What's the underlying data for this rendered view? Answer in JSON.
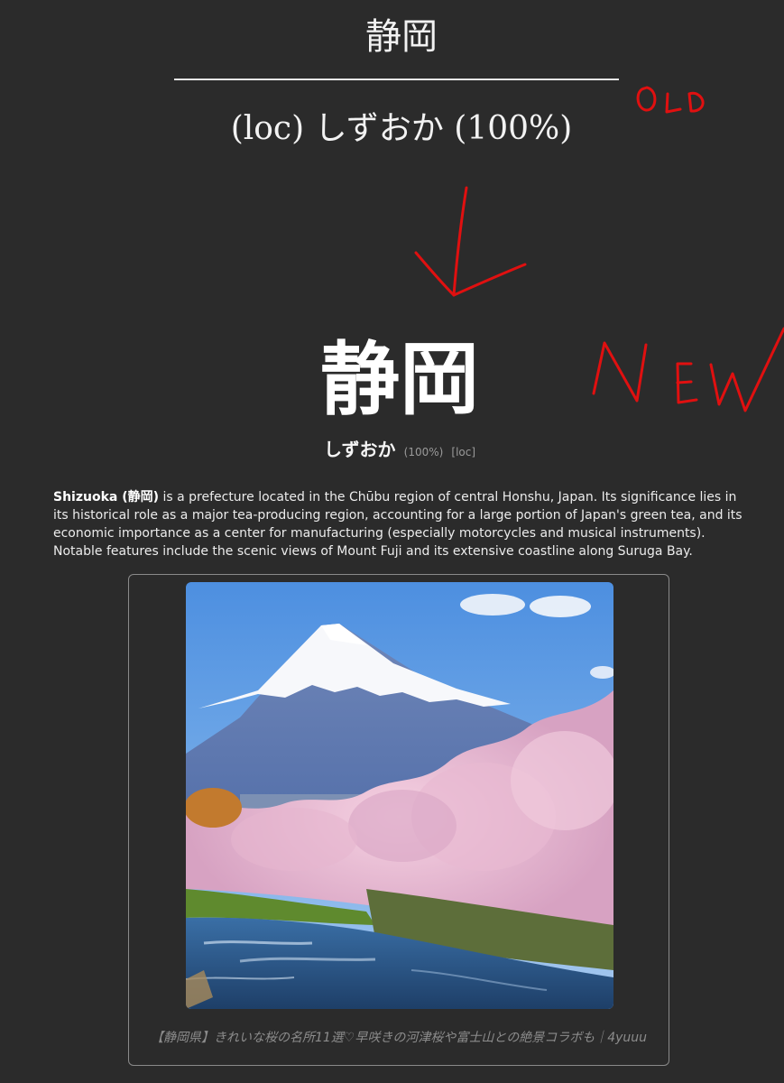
{
  "old": {
    "title": "静岡",
    "reading": "(loc) しずおか (100%)"
  },
  "annotations": {
    "old_label": "OLD",
    "new_label": "NEW",
    "color": "#e01010"
  },
  "new": {
    "title": "静岡",
    "reading": "しずおか",
    "confidence": "(100%)",
    "tag": "[loc]",
    "description": {
      "term": "Shizuoka (静岡)",
      "text": " is a prefecture located in the Chūbu region of central Honshu, Japan. Its significance lies in its historical role as a major tea-producing region, accounting for a large portion of Japan's green tea, and its economic importance as a center for manufacturing (especially motorcycles and musical instruments). Notable features include the scenic views of Mount Fuji and its extensive coastline along Suruga Bay."
    },
    "image": {
      "subject": "Mount Fuji with cherry blossoms along a river",
      "caption": "【静岡県】きれいな桜の名所11選♡早咲きの河津桜や富士山との絶景コラボも｜4yuuu"
    }
  },
  "colors": {
    "background": "#2b2b2b",
    "text": "#ffffff",
    "muted": "#9a9a9a",
    "card_border": "#8a8a8a"
  }
}
